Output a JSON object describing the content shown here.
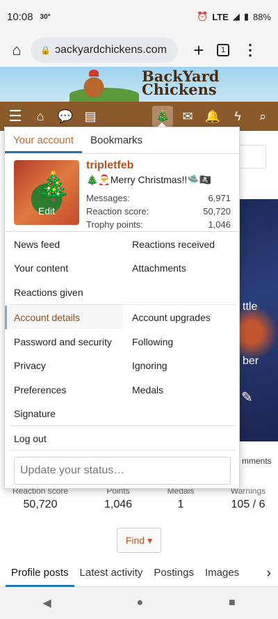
{
  "status_bar": {
    "time": "10:08",
    "temp": "30°",
    "network": "LTE",
    "battery": "88%"
  },
  "browser": {
    "url": "backyardchickens.com",
    "url_display": "ɔackyardchickens.com",
    "tab_count": "1"
  },
  "site": {
    "logo_line1": "BackYard",
    "logo_line2": "Chickens"
  },
  "menu": {
    "tabs": [
      "Your account",
      "Bookmarks"
    ],
    "user": {
      "name": "tripletfeb",
      "title": "🎄🎅Merry Christmas!!🛸🏴‍☠️",
      "avatar_edit": "Edit",
      "stats": [
        {
          "label": "Messages:",
          "value": "6,971"
        },
        {
          "label": "Reaction score:",
          "value": "50,720"
        },
        {
          "label": "Trophy points:",
          "value": "1,046"
        }
      ]
    },
    "links": {
      "news_feed": "News feed",
      "reactions_received": "Reactions received",
      "your_content": "Your content",
      "attachments": "Attachments",
      "reactions_given": "Reactions given",
      "account_details": "Account details",
      "account_upgrades": "Account upgrades",
      "password_security": "Password and security",
      "following": "Following",
      "privacy": "Privacy",
      "ignoring": "Ignoring",
      "preferences": "Preferences",
      "medals": "Medals",
      "signature": "Signature",
      "log_out": "Log out"
    },
    "status_placeholder": "Update your status…"
  },
  "background": {
    "frag1": "ttle",
    "frag2": "ber",
    "frag3": "mments"
  },
  "stats_row": [
    {
      "label": "Reaction score",
      "value": "50,720"
    },
    {
      "label": "Points",
      "value": "1,046"
    },
    {
      "label": "Medals",
      "value": "1"
    },
    {
      "label": "Warnings",
      "value": "105 / 6"
    }
  ],
  "find_button": "Find",
  "profile_tabs": [
    "Profile posts",
    "Latest activity",
    "Postings",
    "Images"
  ]
}
